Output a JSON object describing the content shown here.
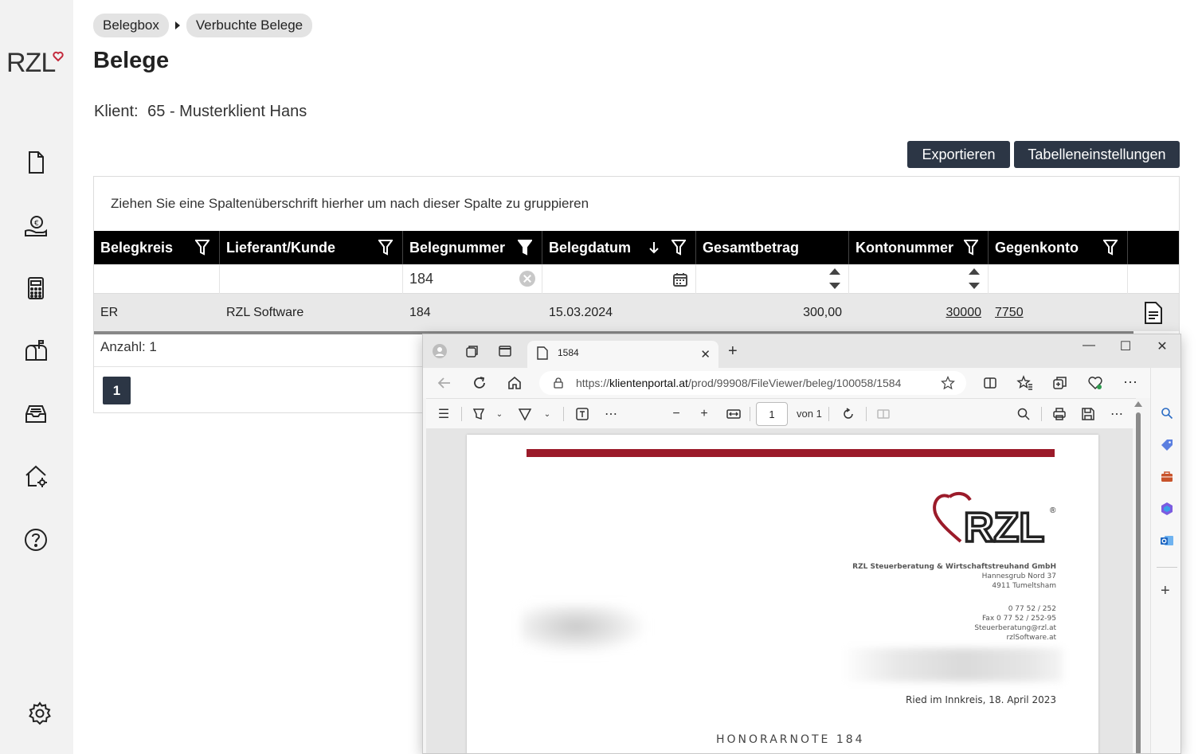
{
  "app": {
    "logo_text": "RZL",
    "sidebar": {
      "items": [
        {
          "name": "document-icon"
        },
        {
          "name": "money-hand-icon"
        },
        {
          "name": "calculator-icon"
        },
        {
          "name": "mailbox-icon"
        },
        {
          "name": "inbox-tray-icon"
        },
        {
          "name": "home-settings-icon"
        },
        {
          "name": "help-icon"
        },
        {
          "name": "settings-gear-icon"
        }
      ]
    },
    "breadcrumb": [
      "Belegbox",
      "Verbuchte Belege"
    ],
    "title": "Belege",
    "client": {
      "label": "Klient:",
      "value": "65 - Musterklient Hans"
    },
    "buttons": {
      "export": "Exportieren",
      "table_settings": "Tabelleneinstellungen"
    },
    "grid": {
      "group_hint": "Ziehen Sie eine Spaltenüberschrift hierher um nach dieser Spalte zu gruppieren",
      "columns": [
        "Belegkreis",
        "Lieferant/Kunde",
        "Belegnummer",
        "Belegdatum",
        "Gesamtbetrag",
        "Kontonummer",
        "Gegenkonto"
      ],
      "filter_value": "184",
      "row": {
        "belegkreis": "ER",
        "lieferant": "RZL Software",
        "belegnummer": "184",
        "belegdatum": "15.03.2024",
        "gesamtbetrag": "300,00",
        "kontonummer": "30000",
        "gegenkonto": "7750"
      },
      "count": "Anzahl: 1",
      "page": "1"
    }
  },
  "browser": {
    "tab_title": "1584",
    "url_prefix": "https://",
    "url_host": "klientenportal.at",
    "url_path": "/prod/99908/FileViewer/beleg/100058/1584",
    "pdf": {
      "page_number": "1",
      "page_of": "von 1",
      "company": "RZL Steuerberatung & Wirtschaftstreuhand GmbH",
      "street": "Hannesgrub Nord 37",
      "city": "4911 Tumeltsham",
      "phone": "0 77 52 / 252",
      "fax": "Fax 0 77 52 / 252-95",
      "email": "Steuerberatung@rzl.at",
      "web": "rzlSoftware.at",
      "date_line": "Ried im Innkreis, 18. April 2023",
      "doc_title": "HONORARNOTE 184",
      "logo_text": "RZL",
      "accent": "#9b1b2a"
    }
  }
}
